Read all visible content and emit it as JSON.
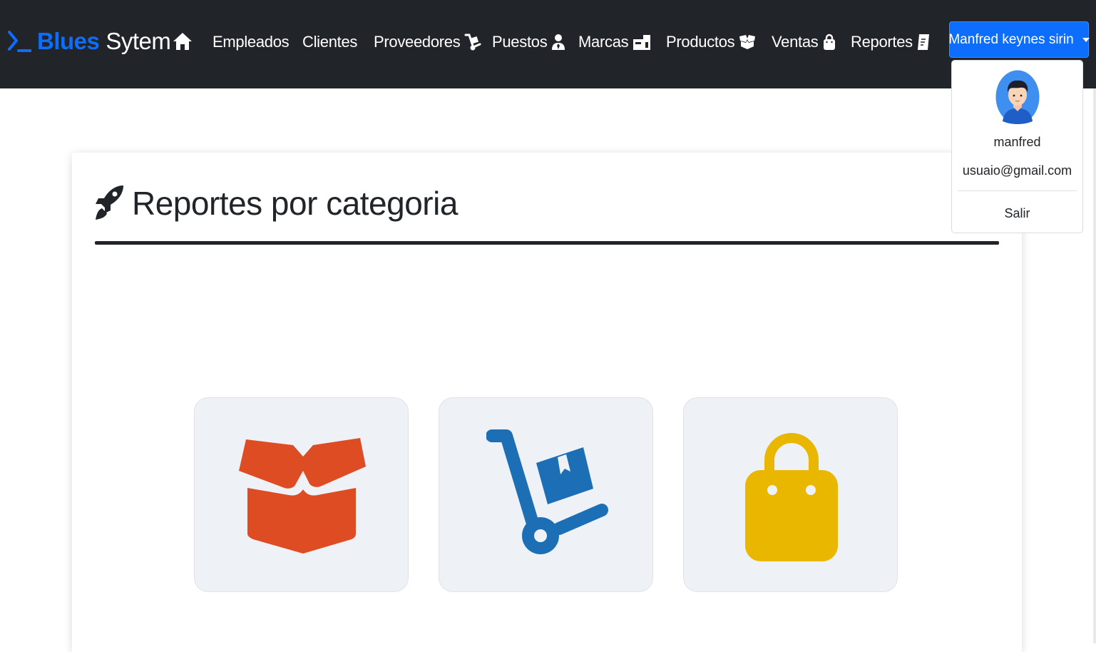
{
  "brand": {
    "part1": "Blues",
    "part2": "Sytem",
    "icon": "terminal-prompt-icon"
  },
  "nav": {
    "home_icon": "home-icon",
    "items": [
      {
        "label": "Empleados",
        "icon": ""
      },
      {
        "label": "Clientes",
        "icon": ""
      },
      {
        "label": "Proveedores",
        "icon": "dolly-icon"
      },
      {
        "label": "Puestos",
        "icon": "user-tie-icon"
      },
      {
        "label": "Marcas",
        "icon": "warehouse-icon"
      },
      {
        "label": "Productos",
        "icon": "box-open-icon"
      },
      {
        "label": "Ventas",
        "icon": "shopping-bag-icon"
      },
      {
        "label": "Reportes",
        "icon": "receipt-icon"
      }
    ]
  },
  "user": {
    "button_label": "Manfred keynes sirin",
    "username": "manfred",
    "email": "usuaio@gmail.com",
    "logout_label": "Salir",
    "avatar_icon": "user-avatar-icon"
  },
  "main": {
    "title": "Reportes por categoria",
    "title_icon": "rocket-icon",
    "tiles": [
      {
        "icon": "box-open-icon",
        "color": "#de4c24"
      },
      {
        "icon": "dolly-icon",
        "color": "#1d6fb5"
      },
      {
        "icon": "shopping-bag-icon",
        "color": "#e9b600"
      }
    ]
  },
  "colors": {
    "navbar": "#212529",
    "accent": "#0d6efd",
    "tile_bg": "#eef1f5"
  }
}
